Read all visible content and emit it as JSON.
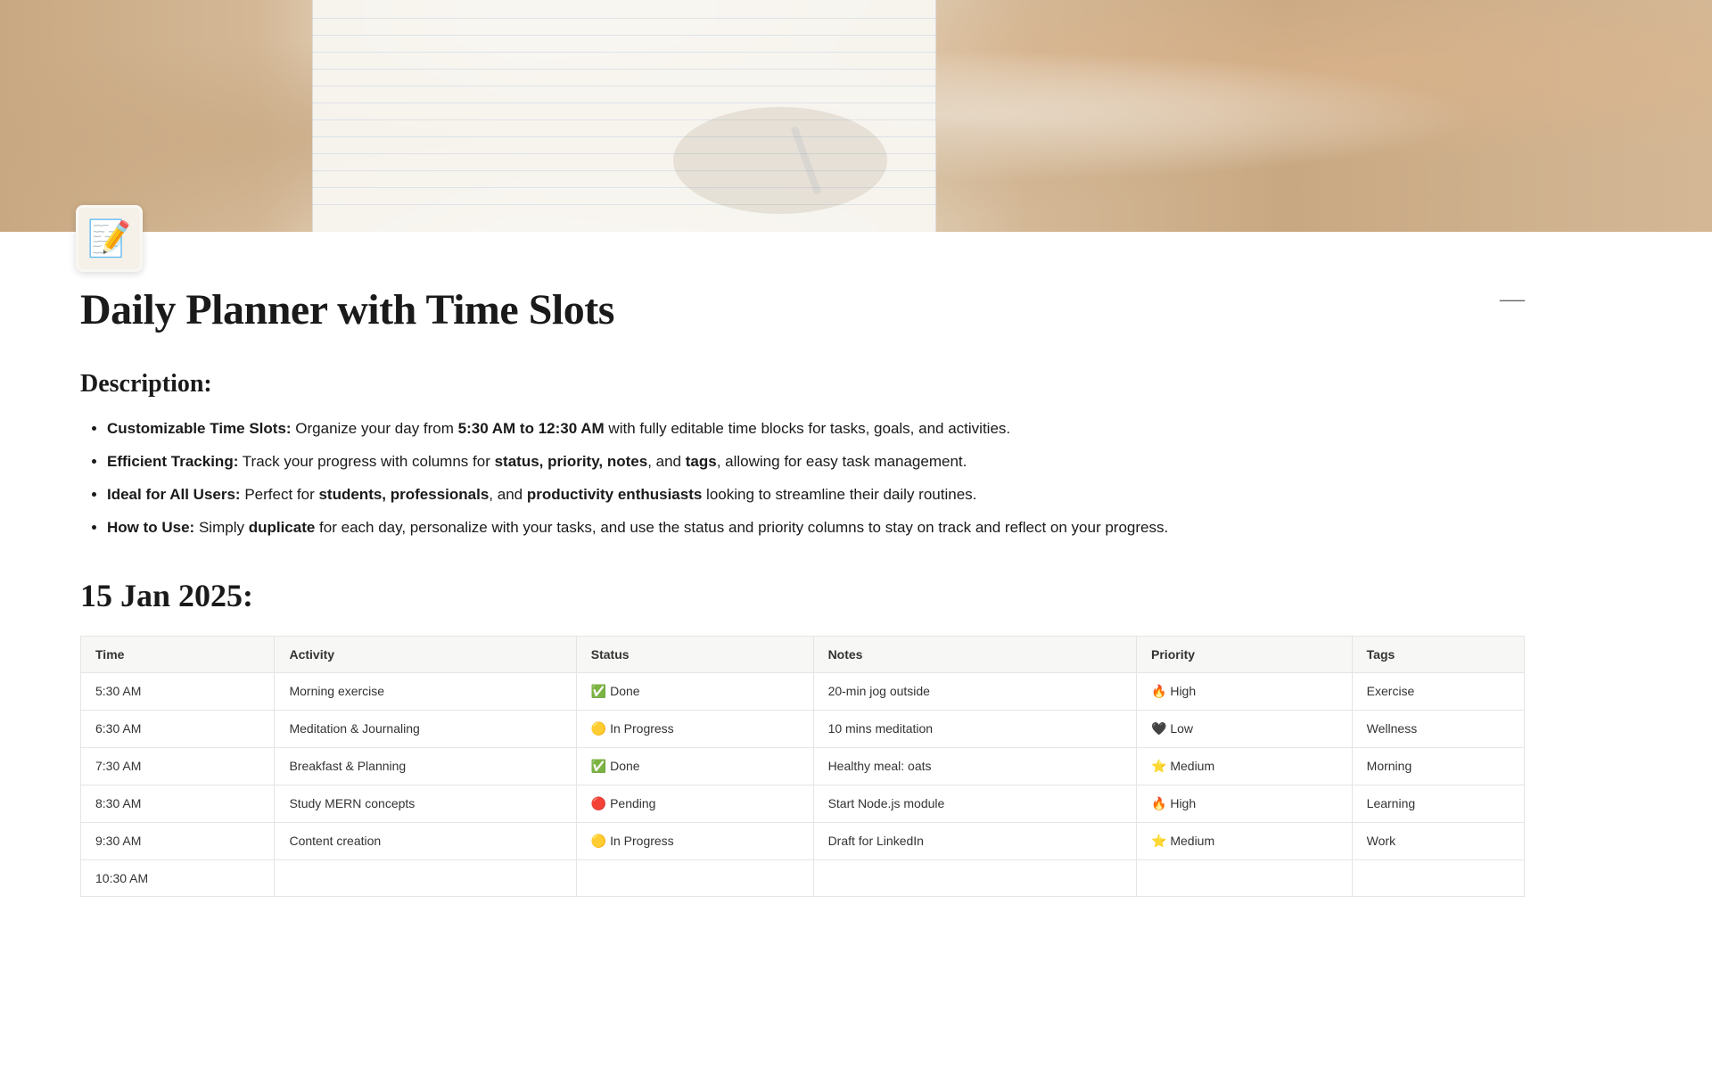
{
  "hero": {
    "icon": "📝"
  },
  "page": {
    "title": "Daily Planner with Time Slots",
    "minimize_btn": "—"
  },
  "description": {
    "heading": "Description:",
    "bullets": [
      {
        "bold_prefix": "Customizable Time Slots:",
        "text": " Organize your day from ",
        "bold_time": "5:30 AM to 12:30 AM",
        "text2": " with fully editable time blocks for tasks, goals, and activities."
      },
      {
        "bold_prefix": "Efficient Tracking:",
        "text": " Track your progress with columns for ",
        "bold_items": "status, priority, notes",
        "text2": ", and ",
        "bold_tags": "tags",
        "text3": ", allowing for easy task management."
      },
      {
        "bold_prefix": "Ideal for All Users:",
        "text": " Perfect for ",
        "bold_users": "students, professionals",
        "text2": ", and ",
        "bold_enthusiasts": "productivity enthusiasts",
        "text3": " looking to streamline their daily routines."
      },
      {
        "bold_prefix": "How to Use:",
        "text": " Simply ",
        "bold_duplicate": "duplicate",
        "text2": " for each day, personalize with your tasks, and use the status and priority columns to stay on track and reflect on your progress."
      }
    ]
  },
  "planner": {
    "date_heading": "15 Jan 2025:",
    "columns": [
      "Time",
      "Activity",
      "Status",
      "Notes",
      "Priority",
      "Tags"
    ],
    "rows": [
      {
        "time": "5:30 AM",
        "activity": "Morning exercise",
        "status_icon": "✅",
        "status": "Done",
        "status_class": "done",
        "notes": "20-min jog outside",
        "priority_icon": "🔥",
        "priority": "High",
        "priority_class": "high",
        "tags": "Exercise"
      },
      {
        "time": "6:30 AM",
        "activity": "Meditation & Journaling",
        "status_icon": "🟡",
        "status": "In Progress",
        "status_class": "inprogress",
        "notes": "10 mins meditation",
        "priority_icon": "🖤",
        "priority": "Low",
        "priority_class": "low",
        "tags": "Wellness"
      },
      {
        "time": "7:30 AM",
        "activity": "Breakfast & Planning",
        "status_icon": "✅",
        "status": "Done",
        "status_class": "done",
        "notes": "Healthy meal: oats",
        "priority_icon": "⭐",
        "priority": "Medium",
        "priority_class": "medium",
        "tags": "Morning"
      },
      {
        "time": "8:30 AM",
        "activity": "Study MERN concepts",
        "status_icon": "🔴",
        "status": "Pending",
        "status_class": "pending",
        "notes": "Start Node.js module",
        "priority_icon": "🔥",
        "priority": "High",
        "priority_class": "high",
        "tags": "Learning"
      },
      {
        "time": "9:30 AM",
        "activity": "Content creation",
        "status_icon": "🟡",
        "status": "In Progress",
        "status_class": "inprogress",
        "notes": "Draft for LinkedIn",
        "priority_icon": "⭐",
        "priority": "Medium",
        "priority_class": "medium",
        "tags": "Work"
      },
      {
        "time": "10:30 AM",
        "activity": "",
        "status_icon": "",
        "status": "",
        "status_class": "",
        "notes": "",
        "priority_icon": "",
        "priority": "",
        "priority_class": "",
        "tags": ""
      }
    ]
  }
}
